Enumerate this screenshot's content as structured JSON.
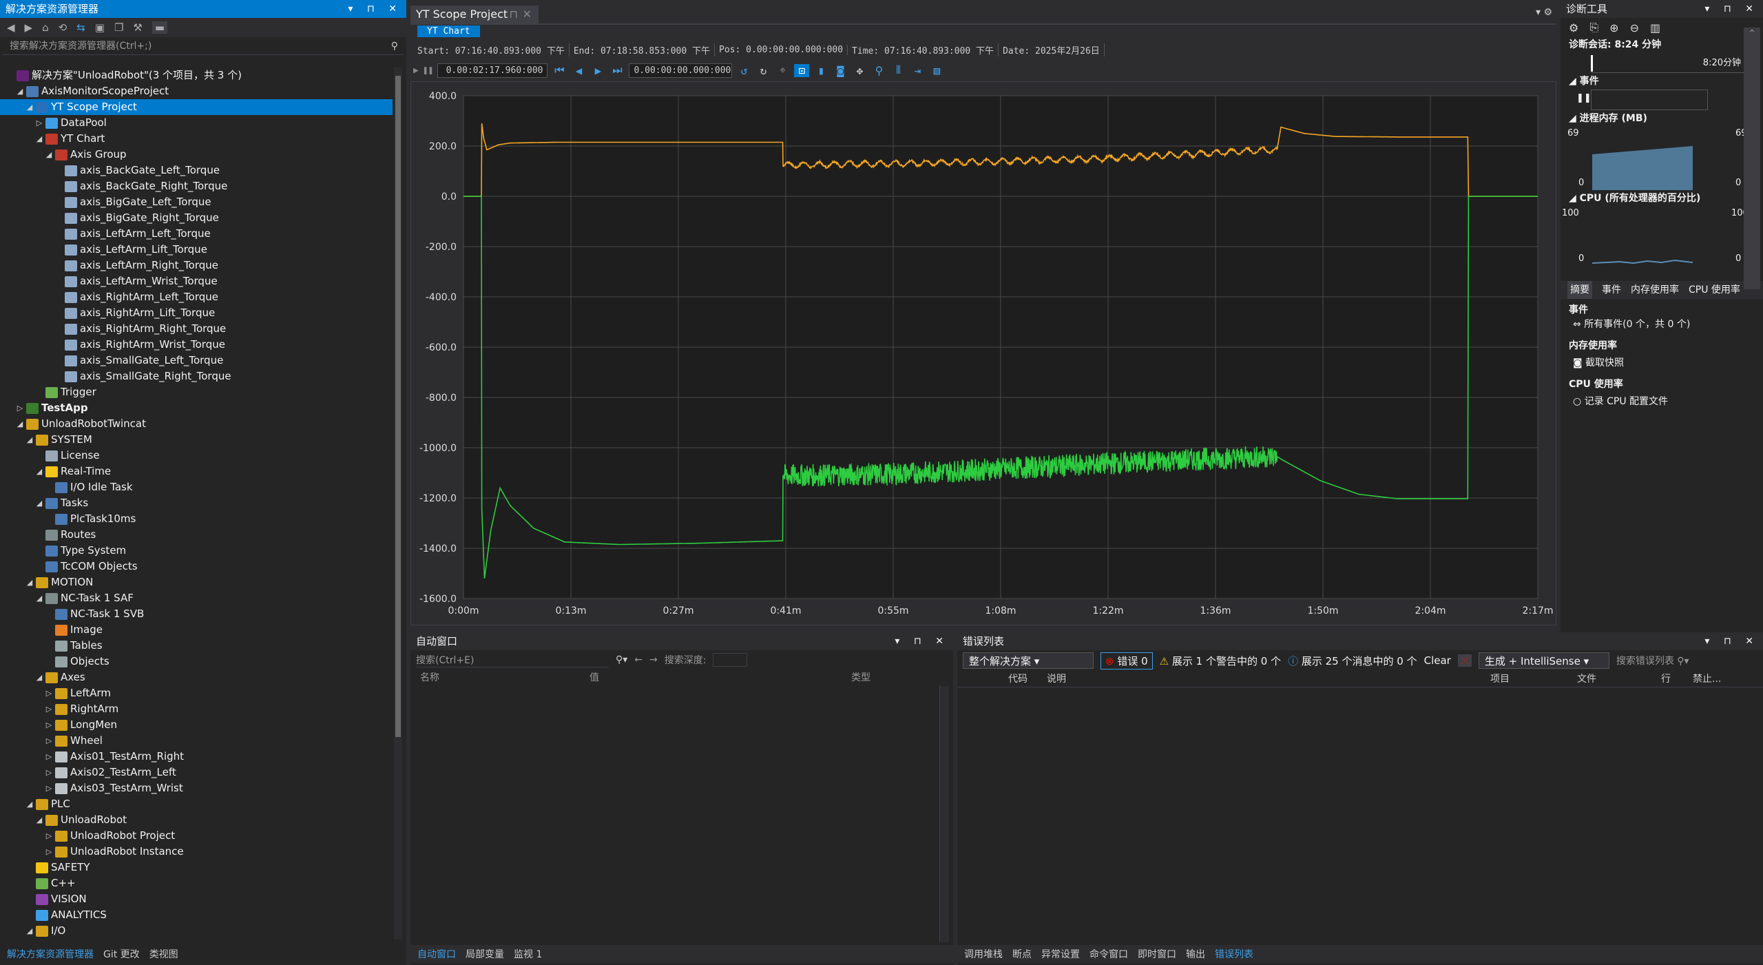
{
  "solution_explorer": {
    "title": "解决方案资源管理器",
    "search_placeholder": "搜索解决方案资源管理器(Ctrl+;)",
    "tree": [
      {
        "label": "解决方案\"UnloadRobot\"(3 个项目，共 3 个)",
        "depth": 0,
        "arrow": "",
        "icon": "solution"
      },
      {
        "label": "AxisMonitorScopeProject",
        "depth": 1,
        "arrow": "◢",
        "icon": "scope"
      },
      {
        "label": "YT Scope Project",
        "depth": 2,
        "arrow": "◢",
        "icon": "yt",
        "sel": true
      },
      {
        "label": "DataPool",
        "depth": 3,
        "arrow": "▷",
        "icon": "db"
      },
      {
        "label": "YT Chart",
        "depth": 3,
        "arrow": "◢",
        "icon": "chart"
      },
      {
        "label": "Axis Group",
        "depth": 4,
        "arrow": "◢",
        "icon": "axisgroup"
      },
      {
        "label": "axis_BackGate_Left_Torque",
        "depth": 5,
        "arrow": "",
        "icon": "axis"
      },
      {
        "label": "axis_BackGate_Right_Torque",
        "depth": 5,
        "arrow": "",
        "icon": "axis"
      },
      {
        "label": "axis_BigGate_Left_Torque",
        "depth": 5,
        "arrow": "",
        "icon": "axis"
      },
      {
        "label": "axis_BigGate_Right_Torque",
        "depth": 5,
        "arrow": "",
        "icon": "axis"
      },
      {
        "label": "axis_LeftArm_Left_Torque",
        "depth": 5,
        "arrow": "",
        "icon": "axis"
      },
      {
        "label": "axis_LeftArm_Lift_Torque",
        "depth": 5,
        "arrow": "",
        "icon": "axis"
      },
      {
        "label": "axis_LeftArm_Right_Torque",
        "depth": 5,
        "arrow": "",
        "icon": "axis"
      },
      {
        "label": "axis_LeftArm_Wrist_Torque",
        "depth": 5,
        "arrow": "",
        "icon": "axis"
      },
      {
        "label": "axis_RightArm_Left_Torque",
        "depth": 5,
        "arrow": "",
        "icon": "axis"
      },
      {
        "label": "axis_RightArm_Lift_Torque",
        "depth": 5,
        "arrow": "",
        "icon": "axis"
      },
      {
        "label": "axis_RightArm_Right_Torque",
        "depth": 5,
        "arrow": "",
        "icon": "axis"
      },
      {
        "label": "axis_RightArm_Wrist_Torque",
        "depth": 5,
        "arrow": "",
        "icon": "axis"
      },
      {
        "label": "axis_SmallGate_Left_Torque",
        "depth": 5,
        "arrow": "",
        "icon": "axis"
      },
      {
        "label": "axis_SmallGate_Right_Torque",
        "depth": 5,
        "arrow": "",
        "icon": "axis"
      },
      {
        "label": "Trigger",
        "depth": 3,
        "arrow": "",
        "icon": "trigger"
      },
      {
        "label": "TestApp",
        "depth": 1,
        "arrow": "▷",
        "icon": "cs",
        "bold": true
      },
      {
        "label": "UnloadRobotTwincat",
        "depth": 1,
        "arrow": "◢",
        "icon": "twincat"
      },
      {
        "label": "SYSTEM",
        "depth": 2,
        "arrow": "◢",
        "icon": "system"
      },
      {
        "label": "License",
        "depth": 3,
        "arrow": "",
        "icon": "doc"
      },
      {
        "label": "Real-Time",
        "depth": 3,
        "arrow": "◢",
        "icon": "rt"
      },
      {
        "label": "I/O Idle Task",
        "depth": 4,
        "arrow": "",
        "icon": "task"
      },
      {
        "label": "Tasks",
        "depth": 3,
        "arrow": "◢",
        "icon": "tasks"
      },
      {
        "label": "PlcTask10ms",
        "depth": 4,
        "arrow": "",
        "icon": "task"
      },
      {
        "label": "Routes",
        "depth": 3,
        "arrow": "",
        "icon": "routes"
      },
      {
        "label": "Type System",
        "depth": 3,
        "arrow": "",
        "icon": "typesys"
      },
      {
        "label": "TcCOM Objects",
        "depth": 3,
        "arrow": "",
        "icon": "tccom"
      },
      {
        "label": "MOTION",
        "depth": 2,
        "arrow": "◢",
        "icon": "motion"
      },
      {
        "label": "NC-Task 1 SAF",
        "depth": 3,
        "arrow": "◢",
        "icon": "nc"
      },
      {
        "label": "NC-Task 1 SVB",
        "depth": 4,
        "arrow": "",
        "icon": "task"
      },
      {
        "label": "Image",
        "depth": 4,
        "arrow": "",
        "icon": "image"
      },
      {
        "label": "Tables",
        "depth": 4,
        "arrow": "",
        "icon": "table"
      },
      {
        "label": "Objects",
        "depth": 4,
        "arrow": "",
        "icon": "objects"
      },
      {
        "label": "Axes",
        "depth": 3,
        "arrow": "◢",
        "icon": "axes"
      },
      {
        "label": "LeftArm",
        "depth": 4,
        "arrow": "▷",
        "icon": "axisfolder"
      },
      {
        "label": "RightArm",
        "depth": 4,
        "arrow": "▷",
        "icon": "axisfolder"
      },
      {
        "label": "LongMen",
        "depth": 4,
        "arrow": "▷",
        "icon": "axisfolder"
      },
      {
        "label": "Wheel",
        "depth": 4,
        "arrow": "▷",
        "icon": "axisfolder"
      },
      {
        "label": "Axis01_TestArm_Right",
        "depth": 4,
        "arrow": "▷",
        "icon": "axisitem"
      },
      {
        "label": "Axis02_TestArm_Left",
        "depth": 4,
        "arrow": "▷",
        "icon": "axisitem"
      },
      {
        "label": "Axis03_TestArm_Wrist",
        "depth": 4,
        "arrow": "▷",
        "icon": "axisitem"
      },
      {
        "label": "PLC",
        "depth": 2,
        "arrow": "◢",
        "icon": "plc"
      },
      {
        "label": "UnloadRobot",
        "depth": 3,
        "arrow": "◢",
        "icon": "plcproj"
      },
      {
        "label": "UnloadRobot Project",
        "depth": 4,
        "arrow": "▷",
        "icon": "plcproj"
      },
      {
        "label": "UnloadRobot Instance",
        "depth": 4,
        "arrow": "▷",
        "icon": "plcinst"
      },
      {
        "label": "SAFETY",
        "depth": 2,
        "arrow": "",
        "icon": "safety"
      },
      {
        "label": "C++",
        "depth": 2,
        "arrow": "",
        "icon": "cpp"
      },
      {
        "label": "VISION",
        "depth": 2,
        "arrow": "",
        "icon": "vision"
      },
      {
        "label": "ANALYTICS",
        "depth": 2,
        "arrow": "",
        "icon": "analytics"
      },
      {
        "label": "I/O",
        "depth": 2,
        "arrow": "◢",
        "icon": "io"
      }
    ],
    "bottom_tabs": [
      "解决方案资源管理器",
      "Git 更改",
      "类视图"
    ]
  },
  "document": {
    "tab_title": "YT Scope Project",
    "chart_chip": "YT Chart",
    "info": {
      "start": "Start: 07:16:40.893:000 下午",
      "end": "End:  07:18:58.853:000  下午",
      "pos": "Pos:  0.00:00:00.000:000",
      "time": "Time: 07:16:40.893:000 下午",
      "date": "Date:  2025年2月26日"
    },
    "time_box": "0.00:02:17.960:000",
    "pos_box": "0.00:00:00.000:000"
  },
  "chart_data": {
    "type": "line",
    "title": "",
    "xlabel": "",
    "ylabel": "",
    "x_ticks": [
      "0:00m",
      "0:13m",
      "0:27m",
      "0:41m",
      "0:55m",
      "1:08m",
      "1:22m",
      "1:36m",
      "1:50m",
      "2:04m",
      "2:17m"
    ],
    "ylim": [
      -1600,
      400
    ],
    "y_ticks": [
      "400.0",
      "200.0",
      "0.0",
      "-200.0",
      "-400.0",
      "-600.0",
      "-800.0",
      "-1000.0",
      "-1200.0",
      "-1400.0",
      "-1600.0"
    ],
    "grid": true,
    "x_unit": "min",
    "series": [
      {
        "color": "#f5a623",
        "points": [
          [
            0,
            0
          ],
          [
            2.3,
            0
          ],
          [
            2.35,
            290
          ],
          [
            2.6,
            230
          ],
          [
            3.0,
            185
          ],
          [
            4.5,
            205
          ],
          [
            6,
            212
          ],
          [
            12,
            215
          ],
          [
            41,
            215
          ],
          [
            41.05,
            120
          ],
          [
            41.1,
            125
          ],
          [
            45,
            125
          ],
          [
            48,
            128
          ],
          [
            55,
            130
          ],
          [
            62,
            135
          ],
          [
            68,
            138
          ],
          [
            75,
            145
          ],
          [
            82,
            150
          ],
          [
            88,
            160
          ],
          [
            95,
            170
          ],
          [
            100,
            180
          ],
          [
            104.5,
            185
          ],
          [
            105,
            275
          ],
          [
            108,
            250
          ],
          [
            112,
            238
          ],
          [
            120,
            236
          ],
          [
            129,
            236
          ],
          [
            129.1,
            0
          ],
          [
            138,
            0
          ]
        ],
        "ripple": 18
      },
      {
        "color": "#2ecc40",
        "points": [
          [
            0,
            0
          ],
          [
            2.3,
            0
          ],
          [
            2.35,
            -1240
          ],
          [
            2.7,
            -1520
          ],
          [
            3.5,
            -1330
          ],
          [
            4.7,
            -1160
          ],
          [
            6,
            -1230
          ],
          [
            9,
            -1320
          ],
          [
            13,
            -1375
          ],
          [
            20,
            -1385
          ],
          [
            30,
            -1380
          ],
          [
            41,
            -1370
          ],
          [
            41.05,
            -1110
          ],
          [
            45,
            -1110
          ],
          [
            55,
            -1105
          ],
          [
            65,
            -1090
          ],
          [
            75,
            -1075
          ],
          [
            85,
            -1060
          ],
          [
            95,
            -1045
          ],
          [
            104.5,
            -1035
          ],
          [
            105,
            -1045
          ],
          [
            110,
            -1130
          ],
          [
            115,
            -1185
          ],
          [
            120,
            -1203
          ],
          [
            129,
            -1203
          ],
          [
            129.1,
            0
          ],
          [
            138,
            0
          ]
        ],
        "noise": 45
      }
    ]
  },
  "diagnostics": {
    "title": "诊断工具",
    "session": "诊断会话: 8:24 分钟",
    "timeline_label": "8:20分钟",
    "events_h": "事件",
    "memory_h": "进程内存 (MB)",
    "memory_max": "69",
    "memory_min": "0",
    "memory_max_r": "69",
    "memory_min_r": "0",
    "cpu_h": "CPU (所有处理器的百分比)",
    "cpu_max": "100",
    "cpu_min": "0",
    "cpu_max_r": "100",
    "cpu_min_r": "0",
    "tabs": [
      "摘要",
      "事件",
      "内存使用率",
      "CPU 使用率"
    ],
    "sec_events": "事件",
    "all_events": "所有事件(0 个，共 0 个)",
    "sec_memory": "内存使用率",
    "snapshot": "截取快照",
    "sec_cpu": "CPU 使用率",
    "record_cpu": "记录 CPU 配置文件"
  },
  "auto_window": {
    "title": "自动窗口",
    "search_placeholder": "搜索(Ctrl+E)",
    "depth_label": "搜索深度:",
    "cols": [
      "名称",
      "值",
      "类型"
    ],
    "bottom_tabs": [
      "自动窗口",
      "局部变量",
      "监视 1"
    ]
  },
  "error_list": {
    "title": "错误列表",
    "scope": "整个解决方案",
    "errors": "错误 0",
    "warnings": "展示 1 个警告中的 0 个",
    "messages": "展示 25 个消息中的 0 个",
    "clear": "Clear",
    "build": "生成 + IntelliSense",
    "search_placeholder": "搜索错误列表",
    "cols": [
      "代码",
      "说明",
      "项目",
      "文件",
      "行",
      "禁止..."
    ],
    "bottom_tabs": [
      "调用堆栈",
      "断点",
      "异常设置",
      "命令窗口",
      "即时窗口",
      "输出",
      "错误列表"
    ]
  }
}
